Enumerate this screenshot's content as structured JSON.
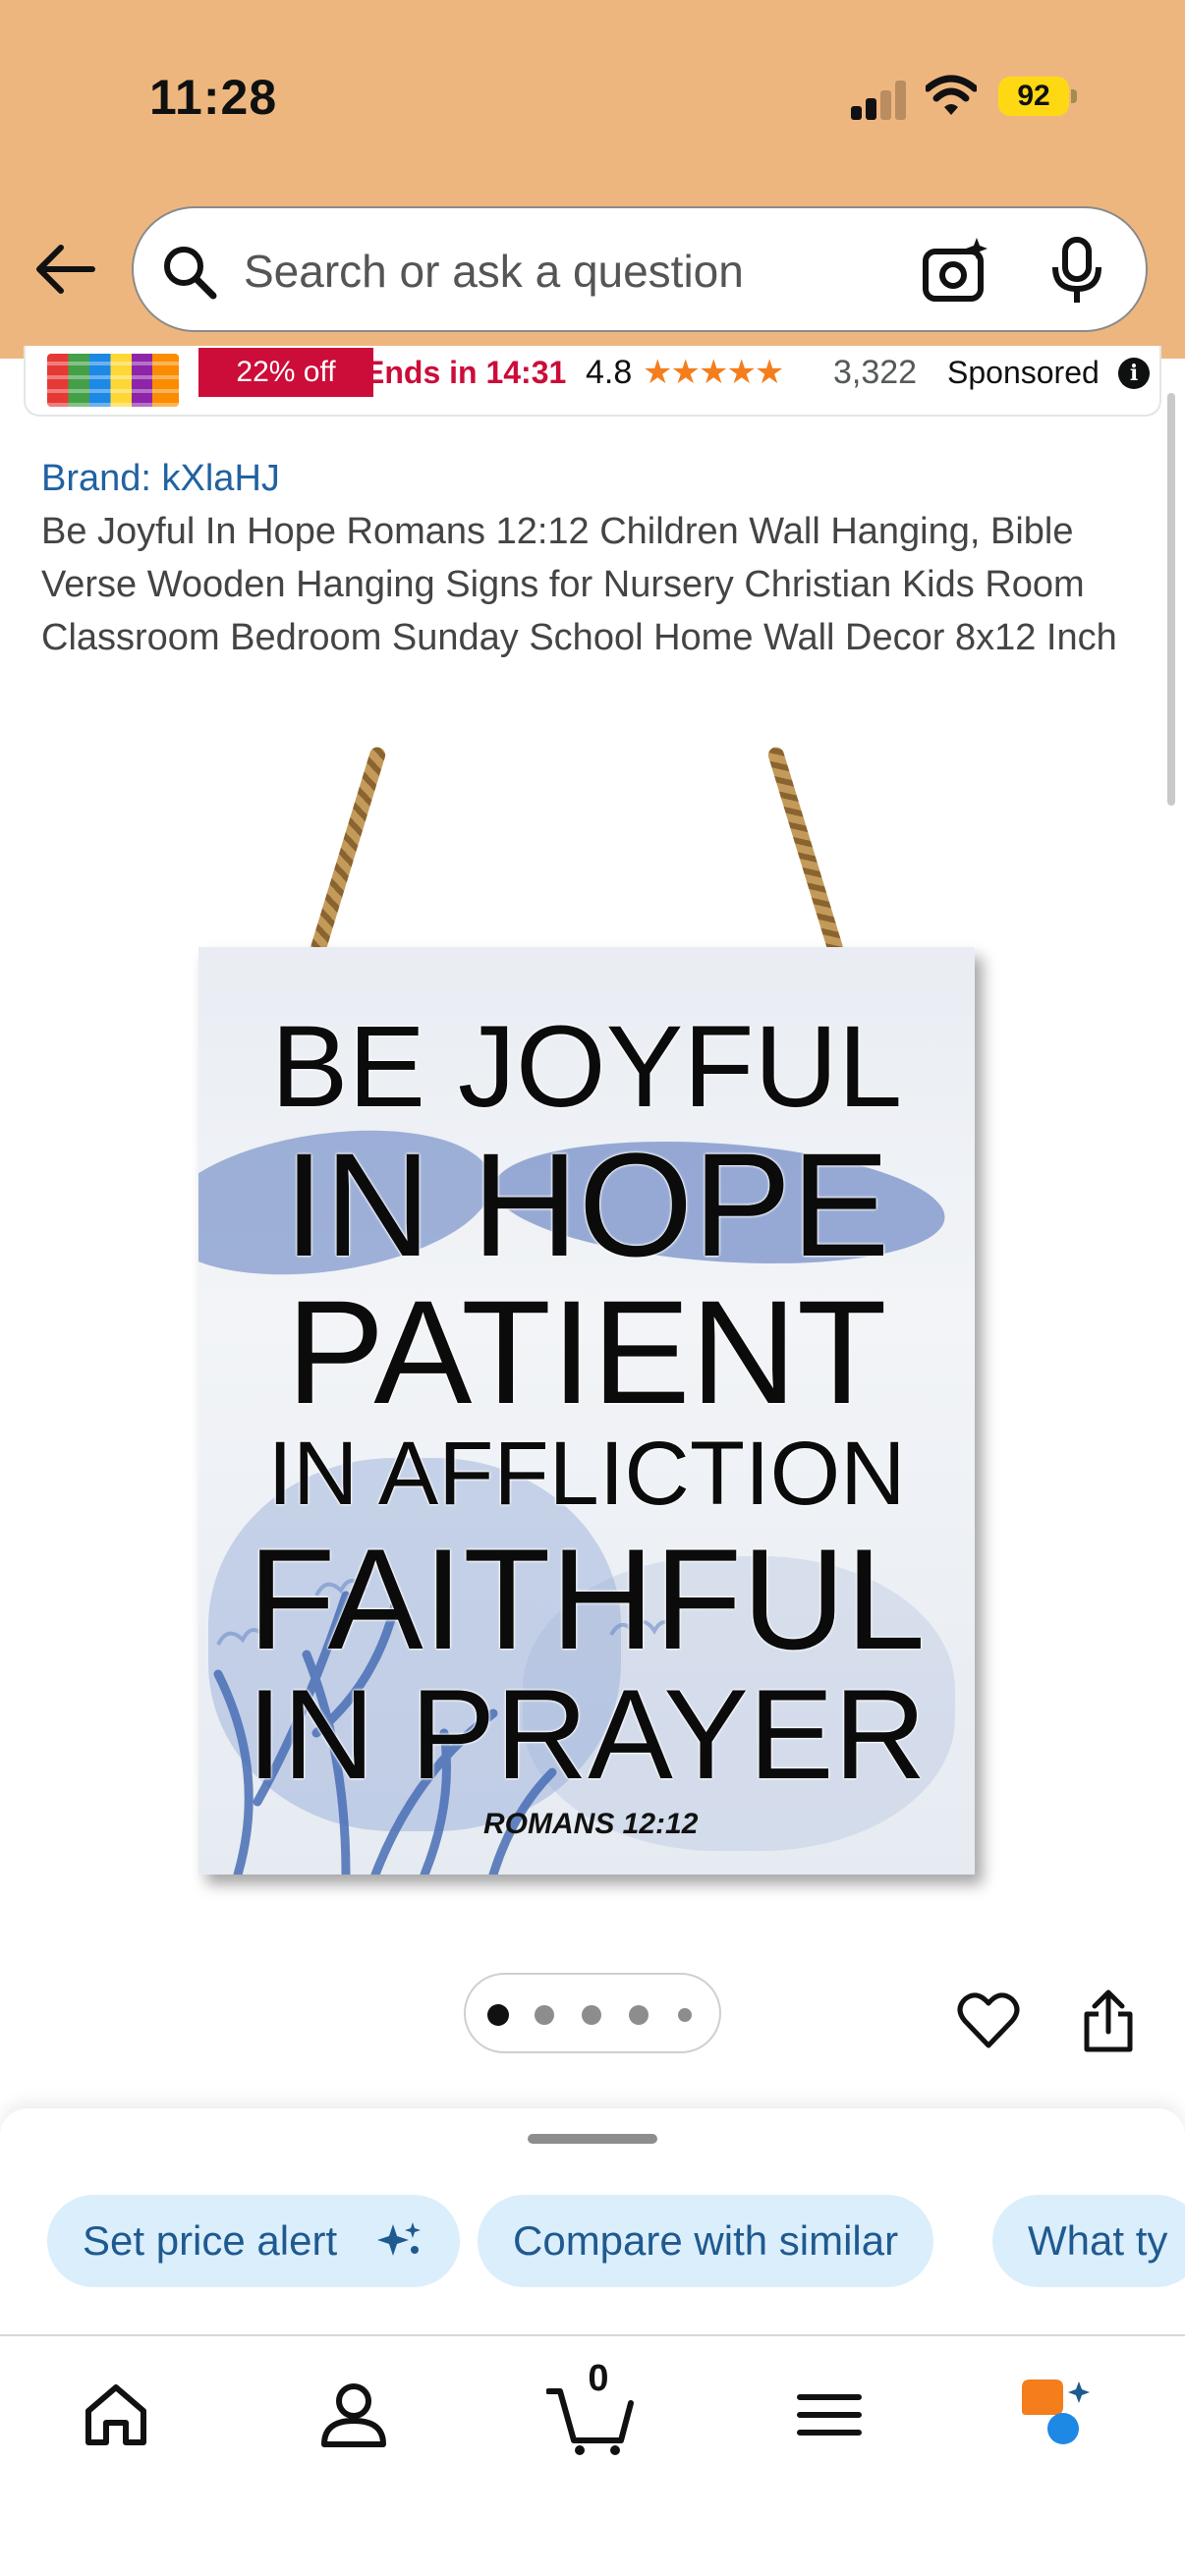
{
  "status_bar": {
    "time": "11:28",
    "battery": "92"
  },
  "search": {
    "placeholder": "Search or ask a question"
  },
  "sponsored": {
    "discount": "22% off",
    "deal_timer": "Ends in 14:31",
    "rating": "4.8",
    "stars": "★★★★★",
    "rating_count": "3,322",
    "label": "Sponsored",
    "info_glyph": "i"
  },
  "product": {
    "brand": "Brand: kXlaHJ",
    "title": "Be Joyful In Hope Romans 12:12 Children Wall Hanging, Bible Verse Wooden Hanging Signs for Nursery Christian Kids Room Classroom Bedroom Sunday School Home Wall Decor 8x12 Inch",
    "image_text": {
      "line1": "BE JOYFUL",
      "line2": "IN HOPE",
      "line3": "PATIENT",
      "line4": "IN AFFLICTION",
      "line5": "FAITHFUL",
      "line6": "IN PRAYER",
      "reference": "ROMANS 12:12"
    }
  },
  "carousel": {
    "total_dots": 5,
    "active_index": 0
  },
  "actions": {
    "chips": [
      "Set price alert",
      "Compare with similar",
      "What ty"
    ]
  },
  "nav": {
    "cart_count": "0"
  },
  "icons": [
    "back-arrow-icon",
    "search-icon",
    "camera-search-icon",
    "microphone-icon",
    "info-icon",
    "heart-icon",
    "share-icon",
    "sparkle-icon",
    "home-icon",
    "account-icon",
    "cart-icon",
    "menu-icon",
    "rufus-icon"
  ],
  "colors": {
    "header_bg": "#eeb67f",
    "deal_red": "#cc0c39",
    "star": "#f47d1c",
    "link_blue": "#2162a1",
    "chip_bg": "#dbeefb"
  }
}
